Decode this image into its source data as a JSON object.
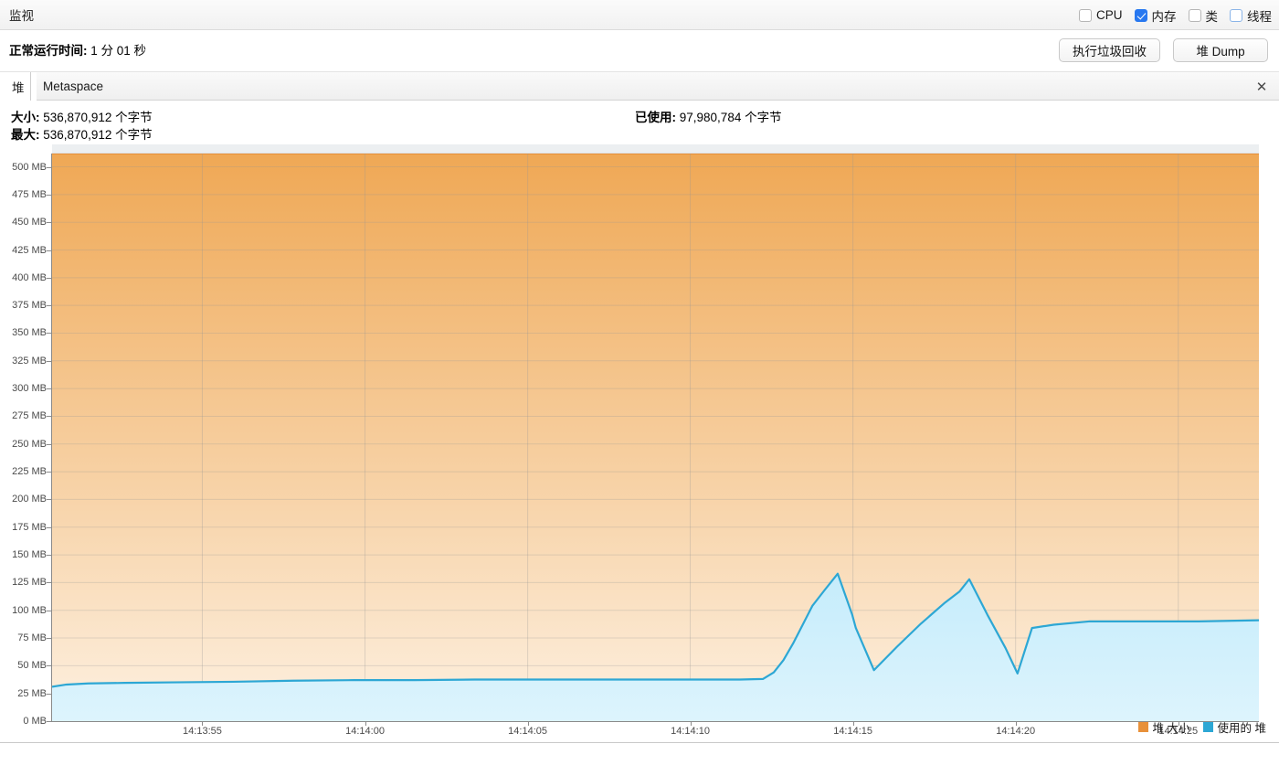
{
  "window": {
    "title": "监视"
  },
  "toggles": [
    {
      "label": "CPU",
      "checked": false,
      "focused": false,
      "name": "checkbox-cpu"
    },
    {
      "label": "内存",
      "checked": true,
      "focused": false,
      "name": "checkbox-memory"
    },
    {
      "label": "类",
      "checked": false,
      "focused": false,
      "name": "checkbox-classes"
    },
    {
      "label": "线程",
      "checked": false,
      "focused": true,
      "name": "checkbox-threads"
    }
  ],
  "uptime": {
    "label": "正常运行时间:",
    "value": "1 分 01 秒"
  },
  "buttons": {
    "gc": "执行垃圾回收",
    "heap_dump": "堆 Dump"
  },
  "tabs": [
    {
      "label": "堆",
      "active": true
    },
    {
      "label": "Metaspace",
      "active": false
    }
  ],
  "tab_close_icon": "✕",
  "info": {
    "size_label": "大小:",
    "size_value": "536,870,912 个字节",
    "max_label": "最大:",
    "max_value": "536,870,912 个字节",
    "used_label": "已使用:",
    "used_value": "97,980,784 个字节"
  },
  "colors": {
    "heap_size_line": "#e8913a",
    "heap_size_fill_top": "#f0b濫",
    "used_heap_line": "#2da7d4",
    "used_heap_fill": "#cdeffc",
    "accent_checked": "#2878f0"
  },
  "chart_data": {
    "type": "area",
    "title": "",
    "xlabel": "",
    "ylabel": "",
    "grid": true,
    "legend_position": "bottom-right",
    "xlim": [
      "14:13:51",
      "14:14:28"
    ],
    "ylim": [
      0,
      512
    ],
    "y_unit": "MB",
    "yticks": [
      0,
      25,
      50,
      75,
      100,
      125,
      150,
      175,
      200,
      225,
      250,
      275,
      300,
      325,
      350,
      375,
      400,
      425,
      450,
      475,
      500
    ],
    "ytick_labels": [
      "0 MB",
      "25 MB",
      "50 MB",
      "75 MB",
      "100 MB",
      "125 MB",
      "150 MB",
      "175 MB",
      "200 MB",
      "225 MB",
      "250 MB",
      "275 MB",
      "300 MB",
      "325 MB",
      "350 MB",
      "375 MB",
      "400 MB",
      "425 MB",
      "450 MB",
      "475 MB",
      "500 MB"
    ],
    "xticks": [
      "14:13:55",
      "14:14:00",
      "14:14:05",
      "14:14:10",
      "14:14:15",
      "14:14:20",
      "14:14:25"
    ],
    "xtick_positions": [
      0.1245,
      0.2593,
      0.3941,
      0.5288,
      0.6636,
      0.7984,
      0.9332
    ],
    "series": [
      {
        "name": "堆 大小",
        "color": "#e8913a",
        "fill": "#f7cf9e",
        "constant_value": 512,
        "x": [
          0,
          1
        ],
        "values": [
          512,
          512
        ]
      },
      {
        "name": "使用的 堆",
        "color": "#2da7d4",
        "fill": "#cdeffc",
        "x": [
          0.0,
          0.012,
          0.03,
          0.06,
          0.1,
          0.15,
          0.2,
          0.25,
          0.3,
          0.35,
          0.4,
          0.45,
          0.5,
          0.54,
          0.57,
          0.589,
          0.598,
          0.606,
          0.614,
          0.622,
          0.63,
          0.64,
          0.651,
          0.663,
          0.666,
          0.681,
          0.7,
          0.72,
          0.74,
          0.752,
          0.76,
          0.775,
          0.79,
          0.8,
          0.812,
          0.83,
          0.86,
          0.9,
          0.95,
          1.0
        ],
        "values": [
          31,
          33,
          34,
          34.5,
          35,
          35.5,
          36.5,
          37,
          37,
          37.5,
          37.5,
          37.5,
          37.5,
          37.5,
          37.5,
          38,
          44,
          55,
          70,
          87,
          104,
          118,
          133,
          96,
          84,
          46,
          67,
          88,
          107,
          117,
          128,
          96,
          66,
          43,
          84,
          87,
          90,
          90,
          90,
          91
        ]
      }
    ]
  },
  "legend": [
    {
      "label": "堆 大小",
      "color": "#e8913a"
    },
    {
      "label": "使用的 堆",
      "color": "#2da7d4"
    }
  ]
}
